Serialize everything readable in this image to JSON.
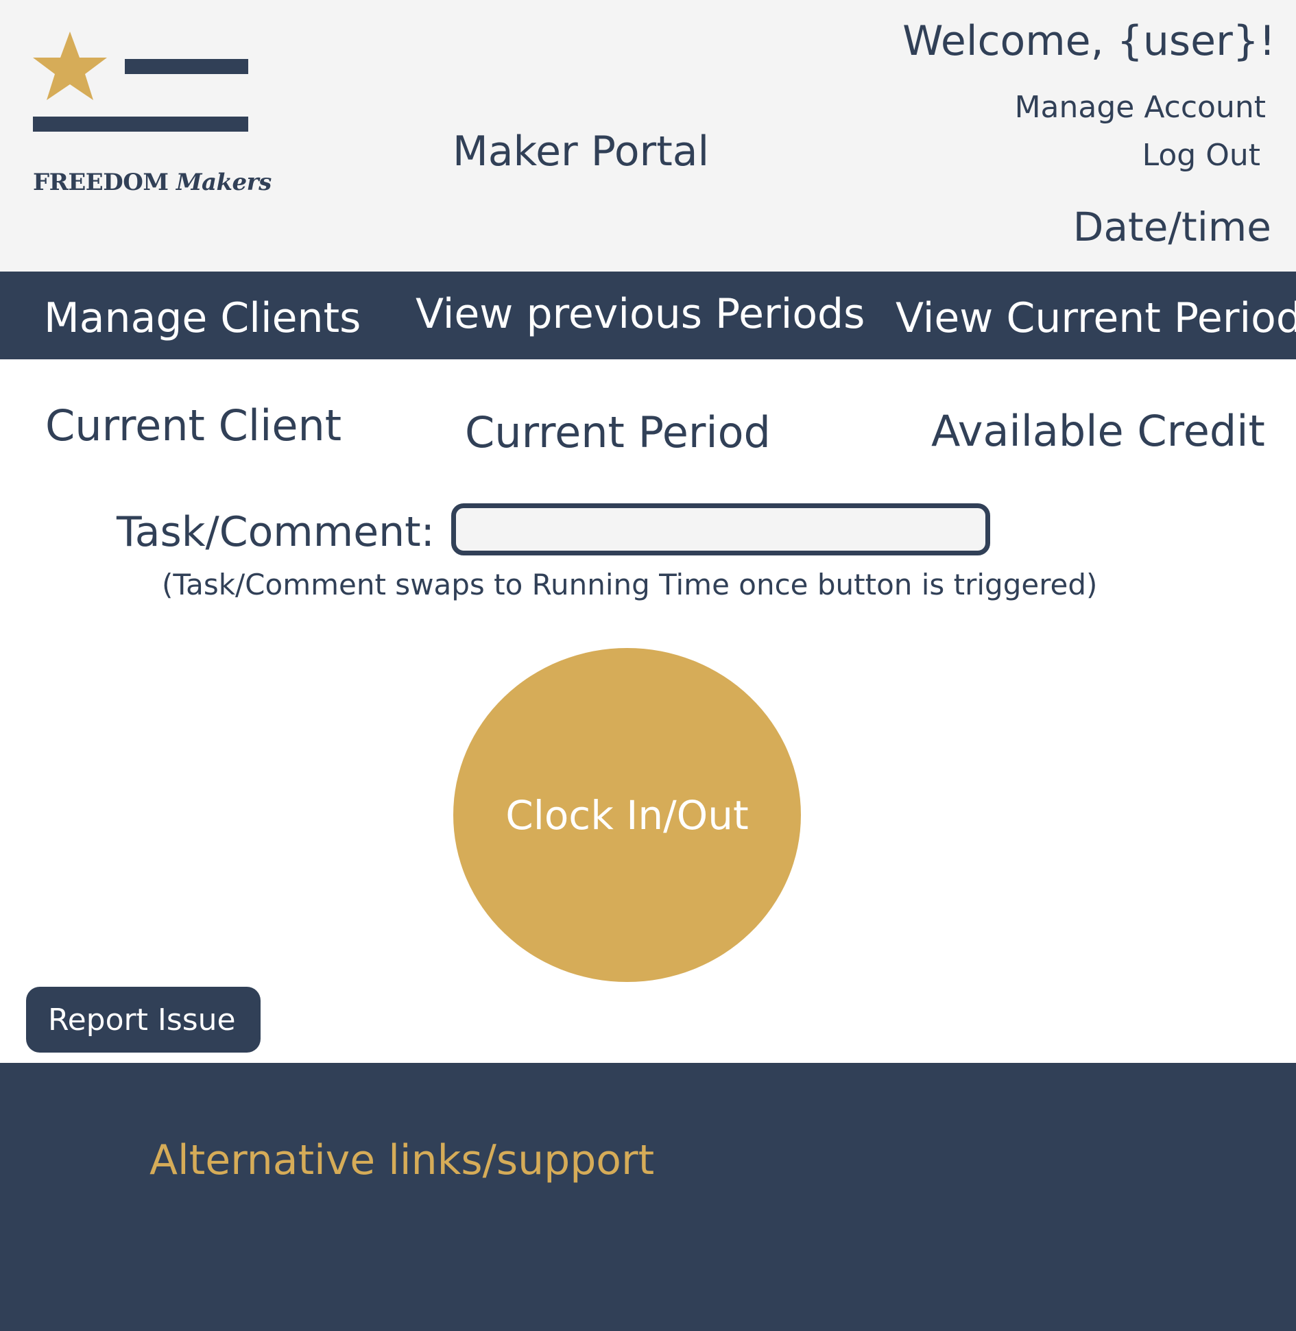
{
  "header": {
    "logo_text": "FREEDOM",
    "logo_text_accent": "Makers",
    "portal_title": "Maker Portal",
    "welcome": "Welcome, {user}!",
    "manage_account": "Manage Account",
    "log_out": "Log Out",
    "datetime": "Date/time"
  },
  "nav": {
    "items": [
      {
        "label": "Manage Clients"
      },
      {
        "label": "View previous Periods"
      },
      {
        "label": "View Current Period"
      }
    ]
  },
  "info": {
    "current_client": "Current Client",
    "current_period": "Current Period",
    "available_credit": "Available Credit"
  },
  "task": {
    "label": "Task/Comment:",
    "value": "",
    "hint": "(Task/Comment swaps to Running Time once button is triggered)"
  },
  "clock_button": {
    "label": "Clock In/Out"
  },
  "report_button": {
    "label": "Report Issue"
  },
  "footer": {
    "link": "Alternative links/support"
  },
  "colors": {
    "navy": "#314057",
    "gold": "#d6ac58",
    "header_bg": "#f4f4f4",
    "white": "#ffffff"
  },
  "icons": {
    "logo": "freedom-makers-star-flag-logo"
  }
}
